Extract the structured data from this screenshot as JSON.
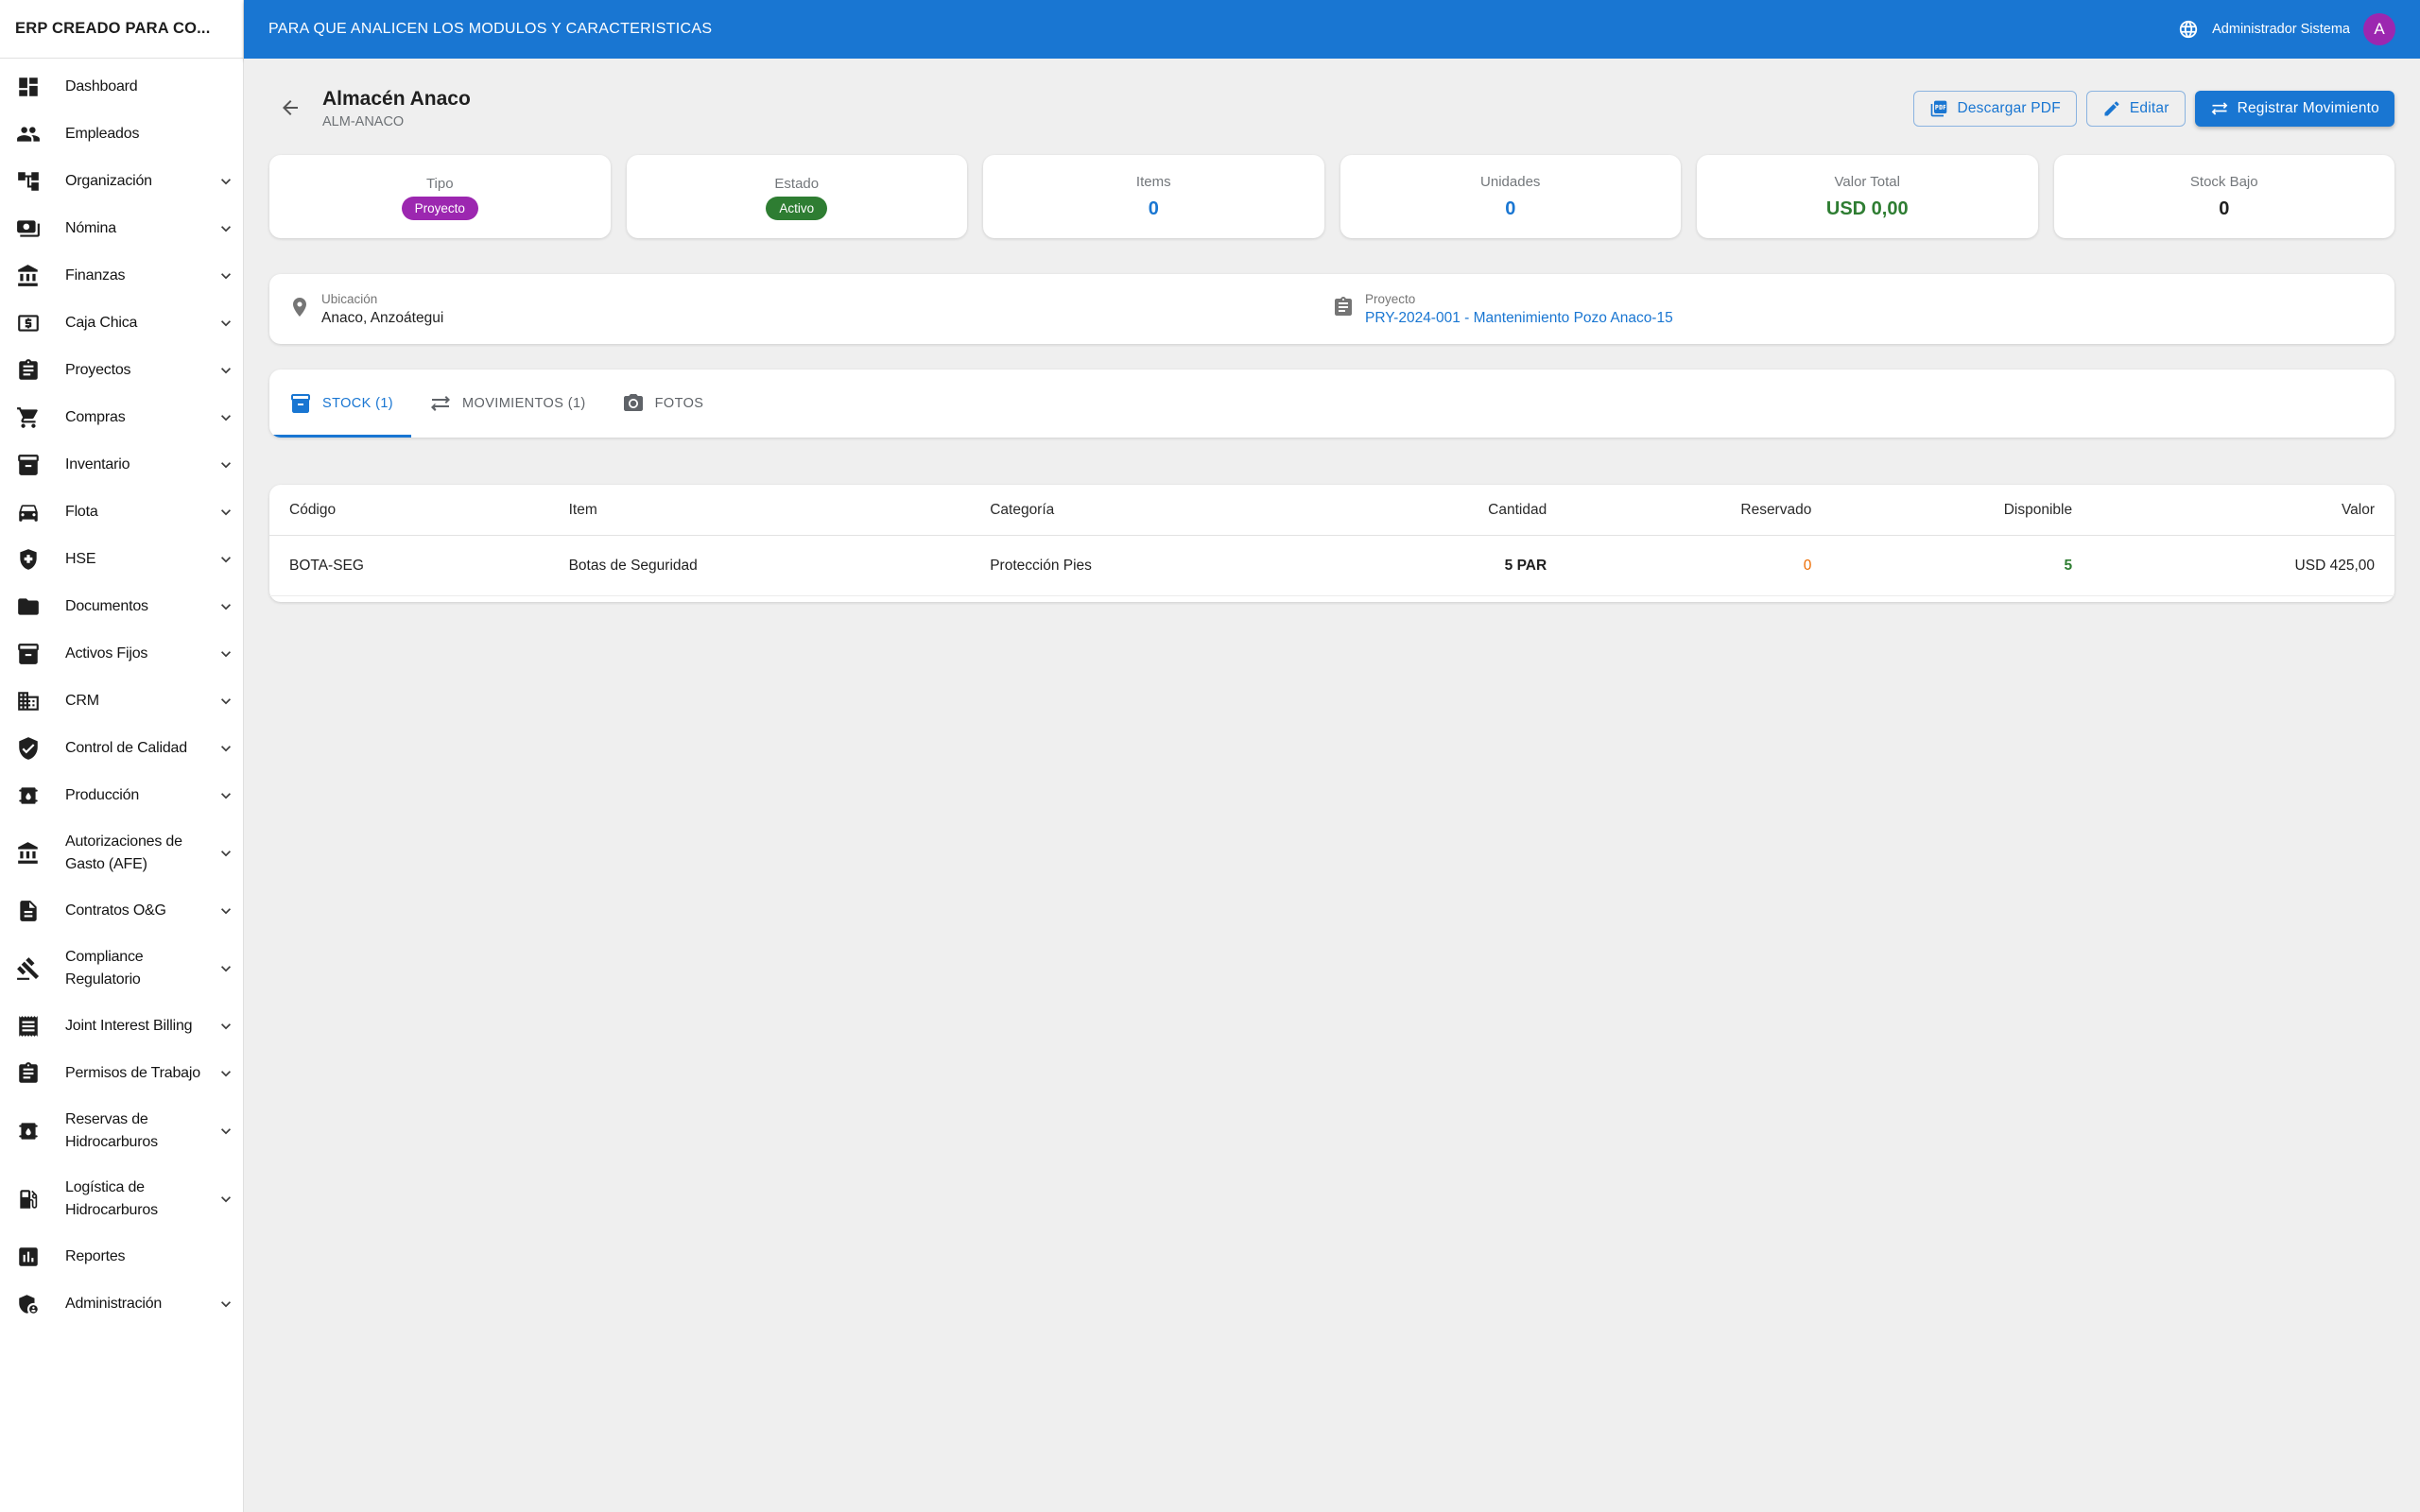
{
  "colors": {
    "primary": "#1976d2",
    "badge_purple": "#9c27b0",
    "badge_green": "#2e7d32",
    "value_orange": "#ed6c02",
    "background": "#efefef"
  },
  "sidebar": {
    "title": "ERP CREADO PARA CO...",
    "items": [
      {
        "label": "Dashboard",
        "icon": "dashboard-icon",
        "expandable": false
      },
      {
        "label": "Empleados",
        "icon": "people-icon",
        "expandable": false
      },
      {
        "label": "Organización",
        "icon": "org-tree-icon",
        "expandable": true
      },
      {
        "label": "Nómina",
        "icon": "payments-icon",
        "expandable": true
      },
      {
        "label": "Finanzas",
        "icon": "bank-icon",
        "expandable": true
      },
      {
        "label": "Caja Chica",
        "icon": "cash-icon",
        "expandable": true
      },
      {
        "label": "Proyectos",
        "icon": "clipboard-icon",
        "expandable": true
      },
      {
        "label": "Compras",
        "icon": "cart-icon",
        "expandable": true
      },
      {
        "label": "Inventario",
        "icon": "inventory-icon",
        "expandable": true
      },
      {
        "label": "Flota",
        "icon": "car-icon",
        "expandable": true
      },
      {
        "label": "HSE",
        "icon": "health-shield-icon",
        "expandable": true
      },
      {
        "label": "Documentos",
        "icon": "folder-icon",
        "expandable": true
      },
      {
        "label": "Activos Fijos",
        "icon": "archive-icon",
        "expandable": true
      },
      {
        "label": "CRM",
        "icon": "building-icon",
        "expandable": true
      },
      {
        "label": "Control de Calidad",
        "icon": "shield-check-icon",
        "expandable": true
      },
      {
        "label": "Producción",
        "icon": "oil-barrel-icon",
        "expandable": true
      },
      {
        "label": "Autorizaciones de Gasto (AFE)",
        "icon": "bank-icon",
        "expandable": true
      },
      {
        "label": "Contratos O&G",
        "icon": "document-icon",
        "expandable": true
      },
      {
        "label": "Compliance Regulatorio",
        "icon": "gavel-icon",
        "expandable": true
      },
      {
        "label": "Joint Interest Billing",
        "icon": "receipt-icon",
        "expandable": true
      },
      {
        "label": "Permisos de Trabajo",
        "icon": "clipboard-icon",
        "expandable": true
      },
      {
        "label": "Reservas de Hidrocarburos",
        "icon": "oil-barrel-icon",
        "expandable": true
      },
      {
        "label": "Logística de Hidrocarburos",
        "icon": "gas-station-icon",
        "expandable": true
      },
      {
        "label": "Reportes",
        "icon": "bar-chart-icon",
        "expandable": false
      },
      {
        "label": "Administración",
        "icon": "admin-shield-icon",
        "expandable": true
      }
    ]
  },
  "topbar": {
    "title": "PARA QUE ANALICEN LOS MODULOS Y CARACTERISTICAS",
    "language_icon": "globe-icon",
    "user": "Administrador Sistema",
    "avatar_initial": "A"
  },
  "header": {
    "back_icon": "back-arrow-icon",
    "title": "Almacén Anaco",
    "code": "ALM-ANACO",
    "actions": [
      {
        "label": "Descargar PDF",
        "icon": "pdf-icon",
        "style": "outlined"
      },
      {
        "label": "Editar",
        "icon": "pencil-icon",
        "style": "outlined"
      },
      {
        "label": "Registrar Movimiento",
        "icon": "swap-arrows-icon",
        "style": "filled"
      }
    ]
  },
  "stats": [
    {
      "label": "Tipo",
      "value": "Proyecto",
      "display": "badge",
      "color": "#9c27b0"
    },
    {
      "label": "Estado",
      "value": "Activo",
      "display": "badge",
      "color": "#2e7d32"
    },
    {
      "label": "Items",
      "value": "0",
      "display": "number",
      "color": "#1976d2"
    },
    {
      "label": "Unidades",
      "value": "0",
      "display": "number",
      "color": "#1976d2"
    },
    {
      "label": "Valor Total",
      "value": "USD 0,00",
      "display": "number",
      "color": "#2e7d32"
    },
    {
      "label": "Stock Bajo",
      "value": "0",
      "display": "number",
      "color": "#212121"
    }
  ],
  "info": {
    "location": {
      "icon": "location-pin-icon",
      "label": "Ubicación",
      "value": "Anaco, Anzoátegui"
    },
    "project": {
      "icon": "clipboard-icon",
      "label": "Proyecto",
      "value": "PRY-2024-001 - Mantenimiento Pozo Anaco-15"
    }
  },
  "tabs": [
    {
      "label": "STOCK (1)",
      "icon": "inventory-icon",
      "active": true
    },
    {
      "label": "MOVIMIENTOS (1)",
      "icon": "swap-arrows-icon",
      "active": false
    },
    {
      "label": "FOTOS",
      "icon": "camera-icon",
      "active": false
    }
  ],
  "stock_table": {
    "columns": [
      "Código",
      "Item",
      "Categoría",
      "Cantidad",
      "Reservado",
      "Disponible",
      "Valor"
    ],
    "rows": [
      {
        "codigo": "BOTA-SEG",
        "item": "Botas de Seguridad",
        "categoria": "Protección Pies",
        "cantidad": "5 PAR",
        "reservado": "0",
        "disponible": "5",
        "valor": "USD 425,00"
      }
    ]
  }
}
